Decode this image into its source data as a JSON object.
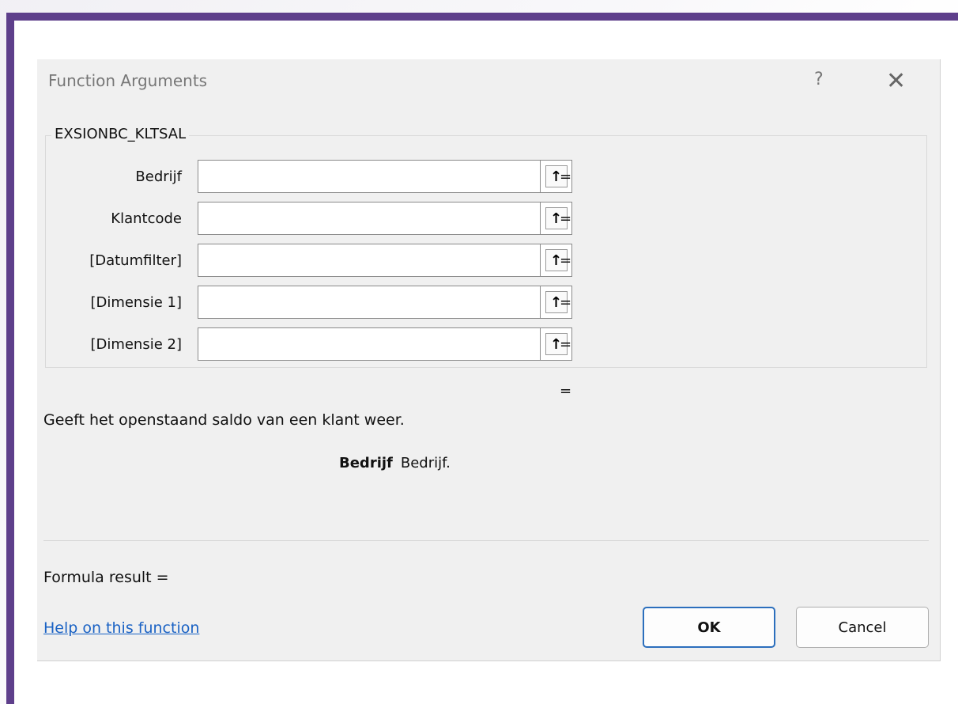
{
  "dialog": {
    "title": "Function Arguments",
    "help_glyph": "?",
    "close_glyph": "✕"
  },
  "function": {
    "name": "EXSIONBC_KLTSAL",
    "arguments": [
      {
        "label": "Bedrijf",
        "value": "",
        "equals": "="
      },
      {
        "label": "Klantcode",
        "value": "",
        "equals": "="
      },
      {
        "label": "[Datumfilter]",
        "value": "",
        "equals": "="
      },
      {
        "label": "[Dimensie 1]",
        "value": "",
        "equals": "="
      },
      {
        "label": "[Dimensie 2]",
        "value": "",
        "equals": "="
      }
    ],
    "ref_icon_glyph": "↑",
    "result_equals": "=",
    "description": "Geeft het openstaand saldo van een klant weer.",
    "selected_arg_name": "Bedrijf",
    "selected_arg_desc": "Bedrijf."
  },
  "footer": {
    "formula_result": "Formula result =",
    "help_link": "Help on this function",
    "ok_label": "OK",
    "cancel_label": "Cancel"
  },
  "colors": {
    "frame": "#5e3f8b",
    "link": "#1a62c4",
    "default_button_border": "#2c6fbd"
  },
  "icons": [
    "help-icon",
    "close-icon",
    "collapse-dialog-icon"
  ]
}
